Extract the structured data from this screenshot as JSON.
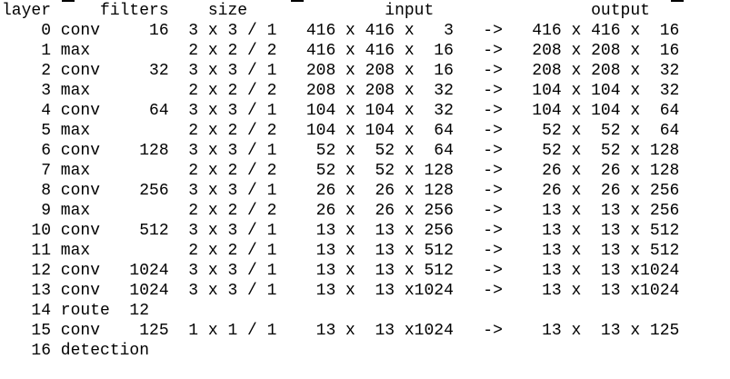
{
  "console": {
    "lines": [
      "layer     filters    size              input                output",
      "    0 conv     16  3 x 3 / 1   416 x 416 x   3   ->   416 x 416 x  16",
      "    1 max          2 x 2 / 2   416 x 416 x  16   ->   208 x 208 x  16",
      "    2 conv     32  3 x 3 / 1   208 x 208 x  16   ->   208 x 208 x  32",
      "    3 max          2 x 2 / 2   208 x 208 x  32   ->   104 x 104 x  32",
      "    4 conv     64  3 x 3 / 1   104 x 104 x  32   ->   104 x 104 x  64",
      "    5 max          2 x 2 / 2   104 x 104 x  64   ->    52 x  52 x  64",
      "    6 conv    128  3 x 3 / 1    52 x  52 x  64   ->    52 x  52 x 128",
      "    7 max          2 x 2 / 2    52 x  52 x 128   ->    26 x  26 x 128",
      "    8 conv    256  3 x 3 / 1    26 x  26 x 128   ->    26 x  26 x 256",
      "    9 max          2 x 2 / 2    26 x  26 x 256   ->    13 x  13 x 256",
      "   10 conv    512  3 x 3 / 1    13 x  13 x 256   ->    13 x  13 x 512",
      "   11 max          2 x 2 / 1    13 x  13 x 512   ->    13 x  13 x 512",
      "   12 conv   1024  3 x 3 / 1    13 x  13 x 512   ->    13 x  13 x1024",
      "   13 conv   1024  3 x 3 / 1    13 x  13 x1024   ->    13 x  13 x1024",
      "   14 route  12",
      "   15 conv    125  1 x 1 / 1    13 x  13 x1024   ->    13 x  13 x 125",
      "   16 detection"
    ]
  }
}
